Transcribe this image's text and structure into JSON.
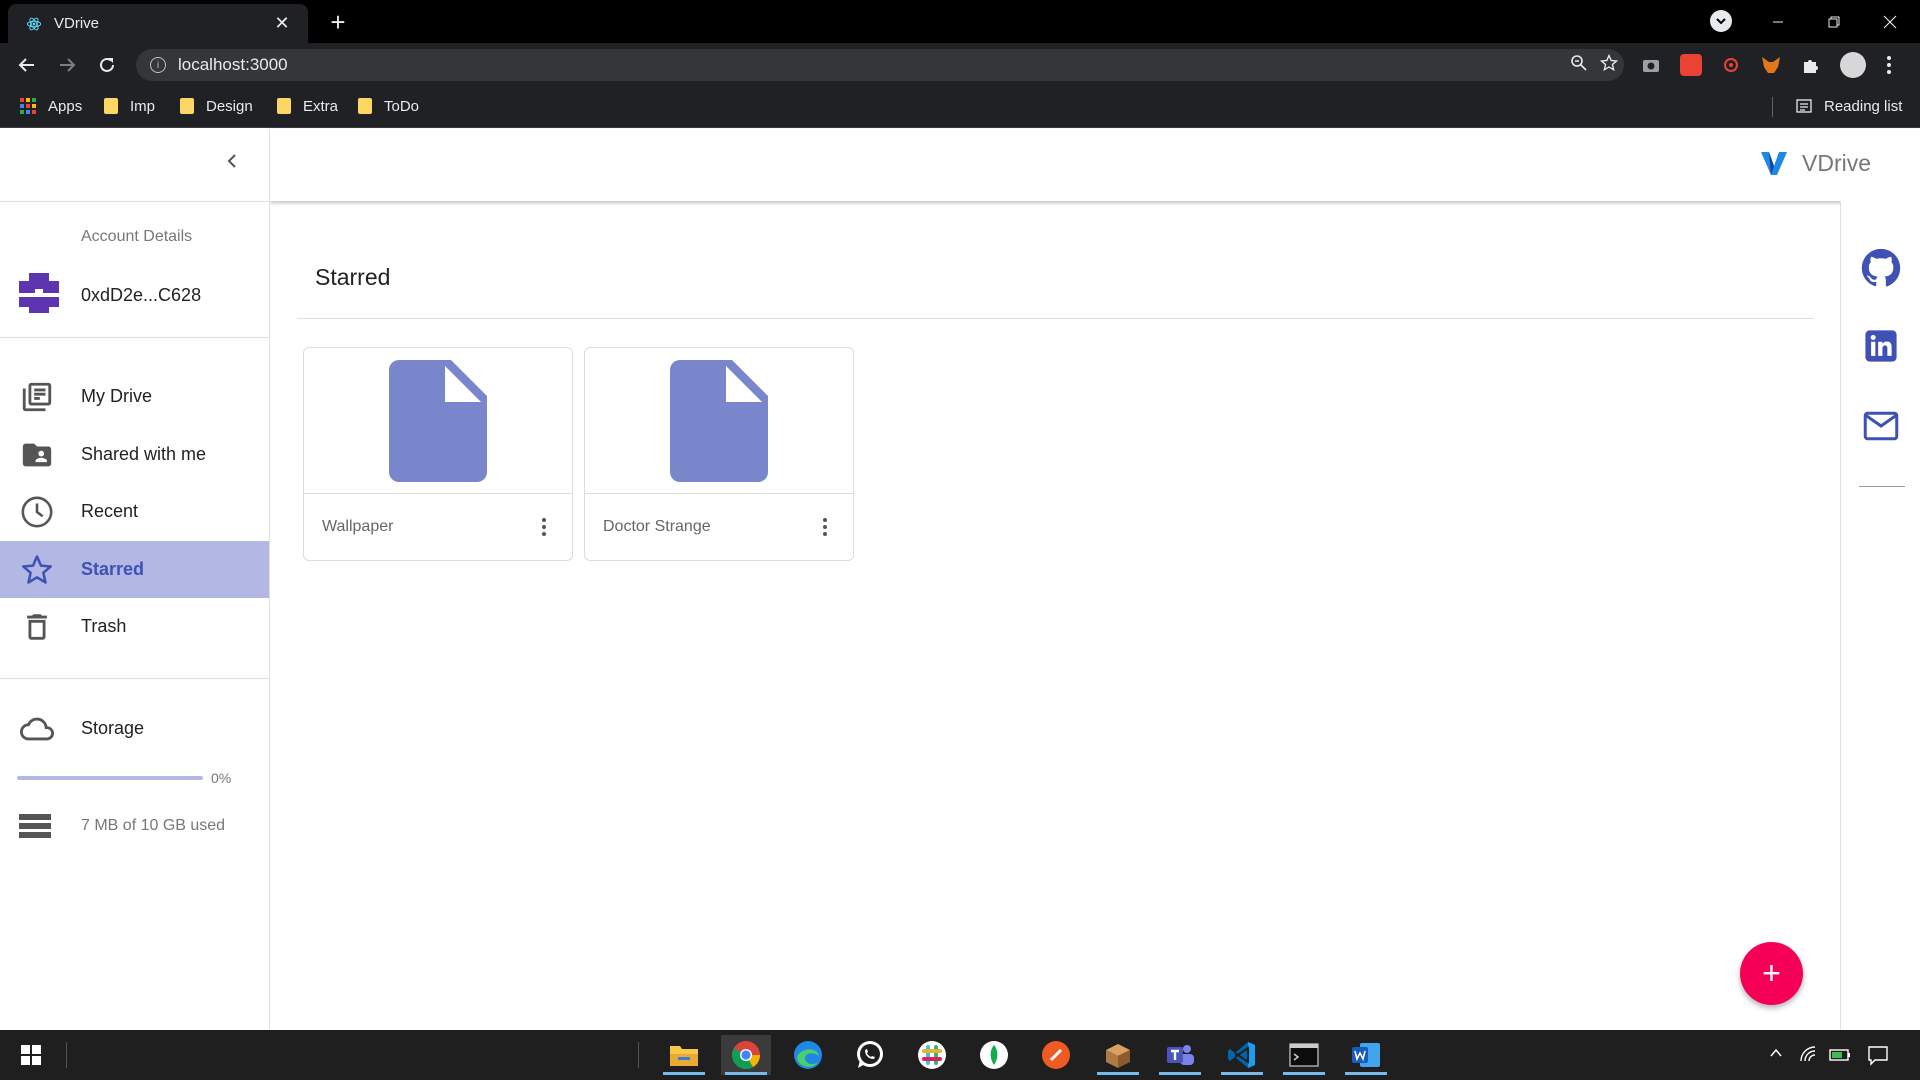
{
  "browser": {
    "tab_title": "VDrive",
    "tab_close": "✕",
    "new_tab": "+",
    "url": "localhost:3000",
    "bookmarks": [
      {
        "label": "Apps"
      },
      {
        "label": "Imp"
      },
      {
        "label": "Design"
      },
      {
        "label": "Extra"
      },
      {
        "label": "ToDo"
      }
    ],
    "reading_list": "Reading list"
  },
  "app": {
    "brand": "VDrive",
    "account": {
      "heading": "Account Details",
      "address": "0xdD2e...C628"
    },
    "nav": [
      {
        "label": "My Drive",
        "icon": "library-books-icon"
      },
      {
        "label": "Shared with me",
        "icon": "shared-folder-icon"
      },
      {
        "label": "Recent",
        "icon": "clock-icon"
      },
      {
        "label": "Starred",
        "icon": "star-icon",
        "active": true
      },
      {
        "label": "Trash",
        "icon": "trash-icon"
      }
    ],
    "storage": {
      "label": "Storage",
      "percent_text": "0%",
      "progress_percent": 0,
      "usage_text": "7 MB of 10 GB used"
    },
    "page_title": "Starred",
    "files": [
      {
        "name": "Wallpaper"
      },
      {
        "name": "Doctor Strange"
      }
    ],
    "fab_label": "+",
    "social": [
      "github-icon",
      "linkedin-icon",
      "mail-icon"
    ]
  },
  "colors": {
    "primary": "#3f51b5",
    "primary_light": "#b2b7e4",
    "file_icon": "#7986cb",
    "fab": "#f50057"
  }
}
